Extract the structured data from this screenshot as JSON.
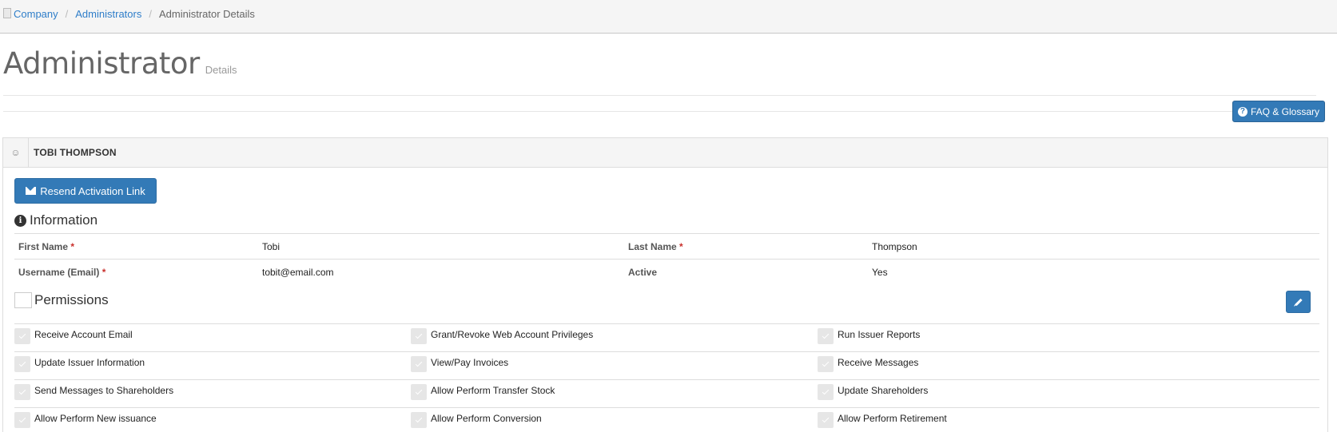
{
  "breadcrumb": {
    "items": [
      "Company",
      "Administrators"
    ],
    "current": "Administrator Details"
  },
  "page": {
    "title": "Administrator",
    "subtitle": "Details"
  },
  "faq_button": "FAQ & Glossary",
  "user_panel": {
    "name": "TOBI THOMPSON",
    "resend_button": "Resend Activation Link"
  },
  "information": {
    "title": "Information",
    "first_name_label": "First Name",
    "first_name": "Tobi",
    "last_name_label": "Last Name",
    "last_name": "Thompson",
    "username_label": "Username (Email)",
    "username": "tobit@email.com",
    "active_label": "Active",
    "active": "Yes",
    "required_mark": "*"
  },
  "permissions": {
    "title": "Permissions",
    "rows": [
      [
        "Receive Account Email",
        "Grant/Revoke Web Account Privileges",
        "Run Issuer Reports"
      ],
      [
        "Update Issuer Information",
        "View/Pay Invoices",
        "Receive Messages"
      ],
      [
        "Send Messages to Shareholders",
        "Allow Perform Transfer Stock",
        "Update Shareholders"
      ],
      [
        "Allow Perform New issuance",
        "Allow Perform Conversion",
        "Allow Perform Retirement"
      ]
    ]
  },
  "colors": {
    "primary": "#337ab7",
    "link": "#2f7ec9",
    "required": "#c9302c"
  }
}
